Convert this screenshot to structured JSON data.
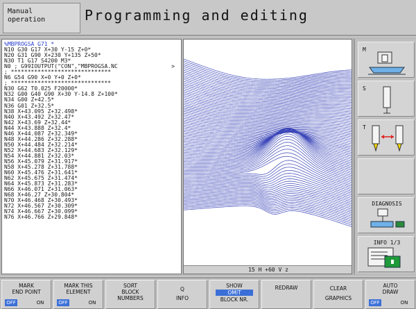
{
  "header": {
    "mode_line1": "Manual",
    "mode_line2": "operation",
    "title": "Programming and editing"
  },
  "program": {
    "lines": [
      "%MBPROGSA G71 *",
      "N10 G30 G17 X+30 Y-15 Z+0*",
      "N20 G31 G90 X+230 Y+135 Z+50*",
      "N30 T1 G17 S4200 M3*",
      "N0 ; G99IOUTPUT(\"CON\",\"MBPROGSA.NC",
      "; ******************************",
      "N6 G54 G90 X+0 Y+0 Z+0*",
      "; ******************************",
      "N30 G62 T0.025 F20000*",
      "N32 G00 G40 G90 X+30 Y-14.8 Z+100*",
      "N34 G00 Z+42.5*",
      "N36 G01 Z+32.5*",
      "N38 X+43.095 Z+32.498*",
      "N40 X+43.492 Z+32.47*",
      "N42 X+43.69 Z+32.44*",
      "N44 X+43.888 Z+32.4*",
      "N46 X+44.087 Z+32.349*",
      "N48 X+44.286 Z+32.288*",
      "N50 X+44.484 Z+32.214*",
      "N52 X+44.683 Z+32.129*",
      "N54 X+44.881 Z+32.03*",
      "N56 X+45.079 Z+31.917*",
      "N58 X+45.278 Z+31.788*",
      "N60 X+45.476 Z+31.641*",
      "N62 X+45.675 Z+31.474*",
      "N64 X+45.873 Z+31.283*",
      "N66 X+46.071 Z+31.063*",
      "N68 X+46.27 Z+30.804*",
      "N70 X+46.468 Z+30.493*",
      "N72 X+46.567 Z+30.309*",
      "N74 X+46.667 Z+30.099*",
      "N76 X+46.766 Z+29.848*"
    ],
    "more_arrow": ">"
  },
  "graphics": {
    "status": "15 H +60 V z"
  },
  "sidebar": {
    "m_label": "M",
    "s_label": "S",
    "t_label": "T",
    "diagnosis_label": "DIAGNOSIS",
    "info_label": "INFO 1/3"
  },
  "softkeys": {
    "mark_end_point": [
      "MARK",
      "END POINT"
    ],
    "mark_this_element": [
      "MARK THIS",
      "ELEMENT"
    ],
    "sort_block_numbers": [
      "SORT",
      "BLOCK",
      "NUMBERS"
    ],
    "q_info": [
      "Q",
      "INFO"
    ],
    "show_omit": [
      "SHOW",
      "OMIT",
      "BLOCK NR."
    ],
    "redraw": "REDRAW",
    "clear_graphics": [
      "CLEAR",
      "GRAPHICS"
    ],
    "auto_draw": [
      "AUTO",
      "DRAW"
    ],
    "toggle_off": "OFF",
    "toggle_on": "ON"
  },
  "colors": {
    "accent": "#3b6fd8",
    "toolpath": "#3a45b8"
  }
}
